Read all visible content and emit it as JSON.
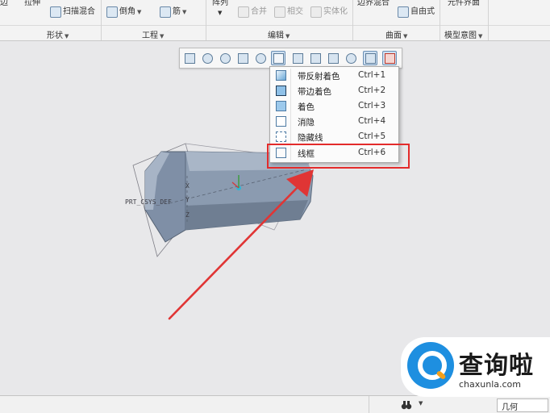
{
  "ribbon": {
    "row1": {
      "extrude": "拉伸",
      "sweep_blend": "扫描混合",
      "chamfer": "倒角",
      "rib": "筋",
      "pattern": "阵列",
      "merge": "合并",
      "intersect": "相交",
      "solidify": "实体化",
      "boundary_blend": "边界混合",
      "freestyle": "自由式",
      "element_interface": "元件界面"
    },
    "groups": {
      "shape": "形状",
      "engineering": "工程",
      "editing": "编辑",
      "surface": "曲面",
      "model_intent": "模型意图"
    }
  },
  "display_menu": {
    "items": [
      {
        "label": "带反射着色",
        "shortcut": "Ctrl+1"
      },
      {
        "label": "带边着色",
        "shortcut": "Ctrl+2"
      },
      {
        "label": "着色",
        "shortcut": "Ctrl+3"
      },
      {
        "label": "消隐",
        "shortcut": "Ctrl+4"
      },
      {
        "label": "隐藏线",
        "shortcut": "Ctrl+5"
      },
      {
        "label": "线框",
        "shortcut": "Ctrl+6"
      }
    ]
  },
  "model": {
    "csys_label": "PRT_CSYS_DEF",
    "axis_x": "X",
    "axis_y": "Y",
    "axis_z": "Z"
  },
  "statusbar": {
    "filter_label": "几何"
  },
  "watermark": {
    "brand_cn": "查询啦",
    "brand_url": "chaxunla.com"
  },
  "colors": {
    "highlight": "#e32b2b",
    "arrow": "#e03535",
    "model_body": "#8b9bb0",
    "watermark_blue": "#1e8fe0",
    "watermark_orange": "#f5a01a"
  }
}
